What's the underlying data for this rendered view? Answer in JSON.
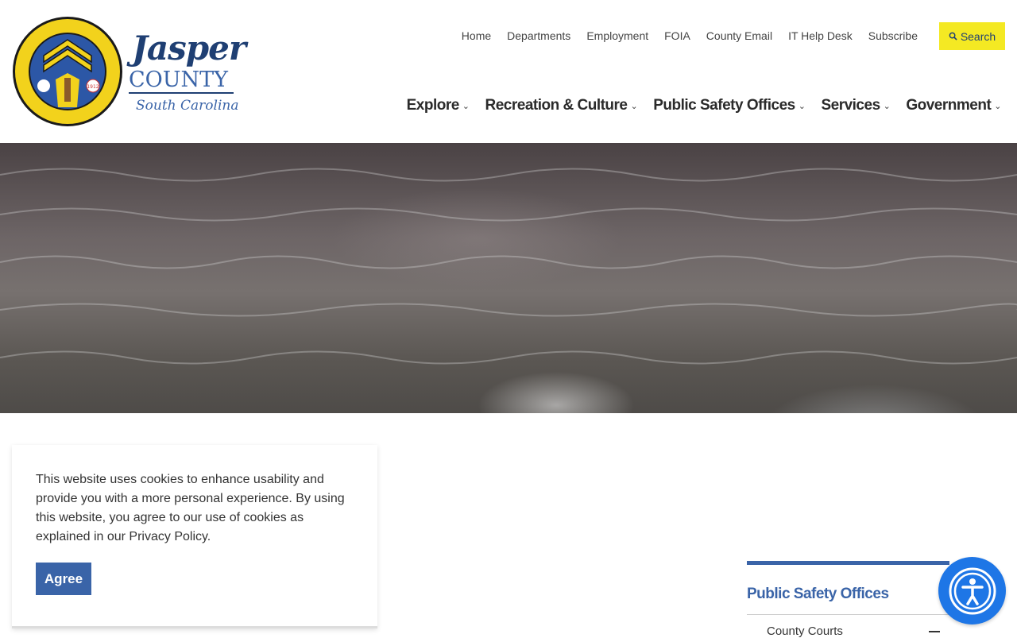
{
  "brand": {
    "name": "Jasper",
    "county": "COUNTY",
    "state": "South Carolina",
    "seal_text": "JASPER COUNTY SOUTH CAROLINA",
    "seal_year": "1912"
  },
  "utility_nav": [
    "Home",
    "Departments",
    "Employment",
    "FOIA",
    "County Email",
    "IT Help Desk",
    "Subscribe"
  ],
  "search": {
    "label": "Search",
    "icon": "search-icon"
  },
  "main_nav": [
    "Explore",
    "Recreation & Culture",
    "Public Safety Offices",
    "Services",
    "Government"
  ],
  "cookie": {
    "text": "This website uses cookies to enhance usability and provide you with a more personal experience. By using this website, you agree to our use of cookies as explained in our Privacy Policy.",
    "button": "Agree"
  },
  "sidebar": {
    "title": "Public Safety Offices",
    "items": [
      "County Courts"
    ]
  },
  "colors": {
    "accent": "#3a64a8",
    "search_bg": "#f4e923",
    "a11y": "#1e76e6",
    "brand_dark": "#1f3f73"
  }
}
